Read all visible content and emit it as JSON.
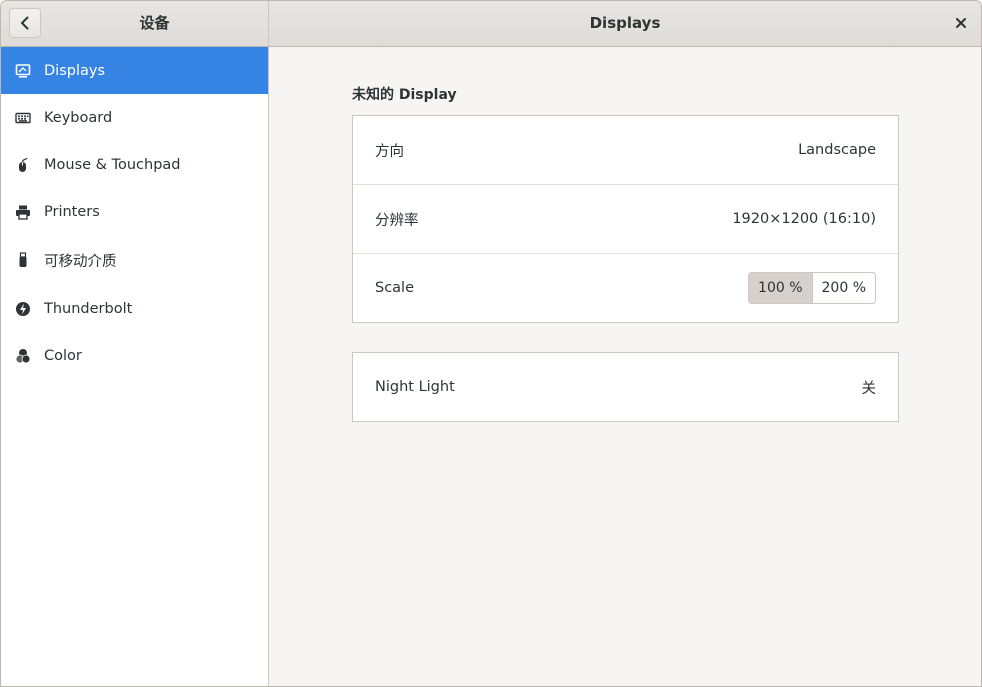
{
  "header": {
    "sidebar_title": "设备",
    "title": "Displays"
  },
  "sidebar": {
    "items": [
      {
        "label": "Displays",
        "icon": "display-icon",
        "active": true
      },
      {
        "label": "Keyboard",
        "icon": "keyboard-icon"
      },
      {
        "label": "Mouse & Touchpad",
        "icon": "mouse-icon"
      },
      {
        "label": "Printers",
        "icon": "printer-icon"
      },
      {
        "label": "可移动介质",
        "icon": "removable-media-icon"
      },
      {
        "label": "Thunderbolt",
        "icon": "thunderbolt-icon"
      },
      {
        "label": "Color",
        "icon": "color-icon"
      }
    ]
  },
  "display": {
    "section_title": "未知的 Display",
    "orientation": {
      "label": "方向",
      "value": "Landscape"
    },
    "resolution": {
      "label": "分辨率",
      "value": "1920×1200 (16:10)"
    },
    "scale": {
      "label": "Scale",
      "options": [
        "100 %",
        "200 %"
      ],
      "selected": "100 %"
    }
  },
  "night_light": {
    "label": "Night Light",
    "value": "关"
  },
  "colors": {
    "accent": "#3584e4",
    "background": "#f6f5f4",
    "selected_toggle": "#d6d1cd"
  }
}
